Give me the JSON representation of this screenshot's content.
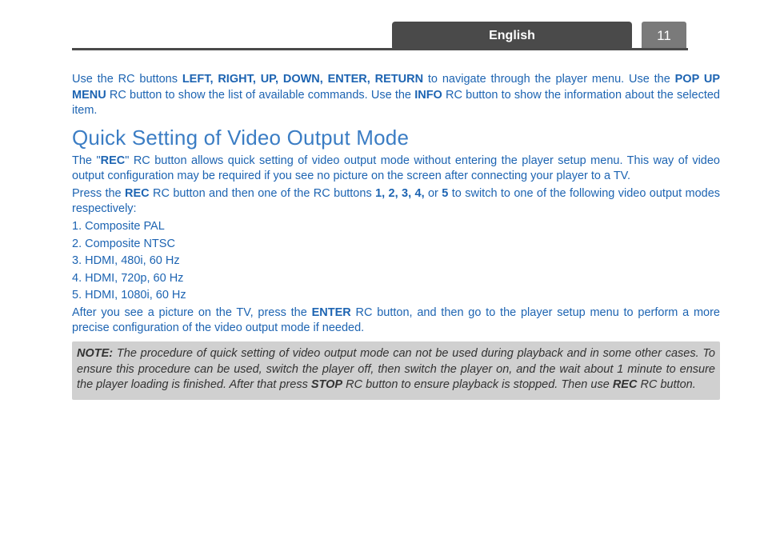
{
  "header": {
    "language": "English",
    "page_number": "11"
  },
  "intro": {
    "p1_a": "Use the RC buttons ",
    "p1_b": "LEFT, RIGHT, UP, DOWN, ENTER, RETURN",
    "p1_c": " to navigate through the player menu. Use the ",
    "p1_d": "POP UP MENU",
    "p1_e": " RC button to show the list of available commands. Use the ",
    "p1_f": "INFO",
    "p1_g": " RC button to show the information about the selected item."
  },
  "section_heading": "Quick Setting of Video Output Mode",
  "body": {
    "p2_a": "The \"",
    "p2_b": "REC",
    "p2_c": "\" RC button allows quick setting of video output mode without entering the player setup menu. This way of video output configuration may be required if you see no picture on the screen after connecting your player to a TV.",
    "p3_a": "Press the ",
    "p3_b": "REC",
    "p3_c": " RC button and then one of the RC buttons ",
    "p3_d": "1, 2, 3, 4,",
    "p3_e": " or ",
    "p3_f": "5",
    "p3_g": " to switch to one of the following video output modes respectively:"
  },
  "modes": {
    "m1": "1. Composite PAL",
    "m2": "2. Composite NTSC",
    "m3": "3. HDMI, 480i, 60 Hz",
    "m4": "4. HDMI, 720p, 60 Hz",
    "m5": "5. HDMI, 1080i, 60 Hz"
  },
  "after": {
    "a1": "After you see a picture on the TV, press the ",
    "a2": "ENTER",
    "a3": " RC button, and then go to the player setup menu to perform a more precise configuration of the video output mode if needed."
  },
  "note": {
    "n1": "NOTE:",
    "n2": " The procedure of quick setting of video output mode can not be used during playback and in some other cases. To ensure this procedure can be used, switch the player off, then switch the player on, and the wait about 1 minute to ensure the player loading is finished. After that press ",
    "n3": "STOP",
    "n4": " RC button to ensure playback is stopped. Then use ",
    "n5": "REC",
    "n6": " RC button."
  }
}
